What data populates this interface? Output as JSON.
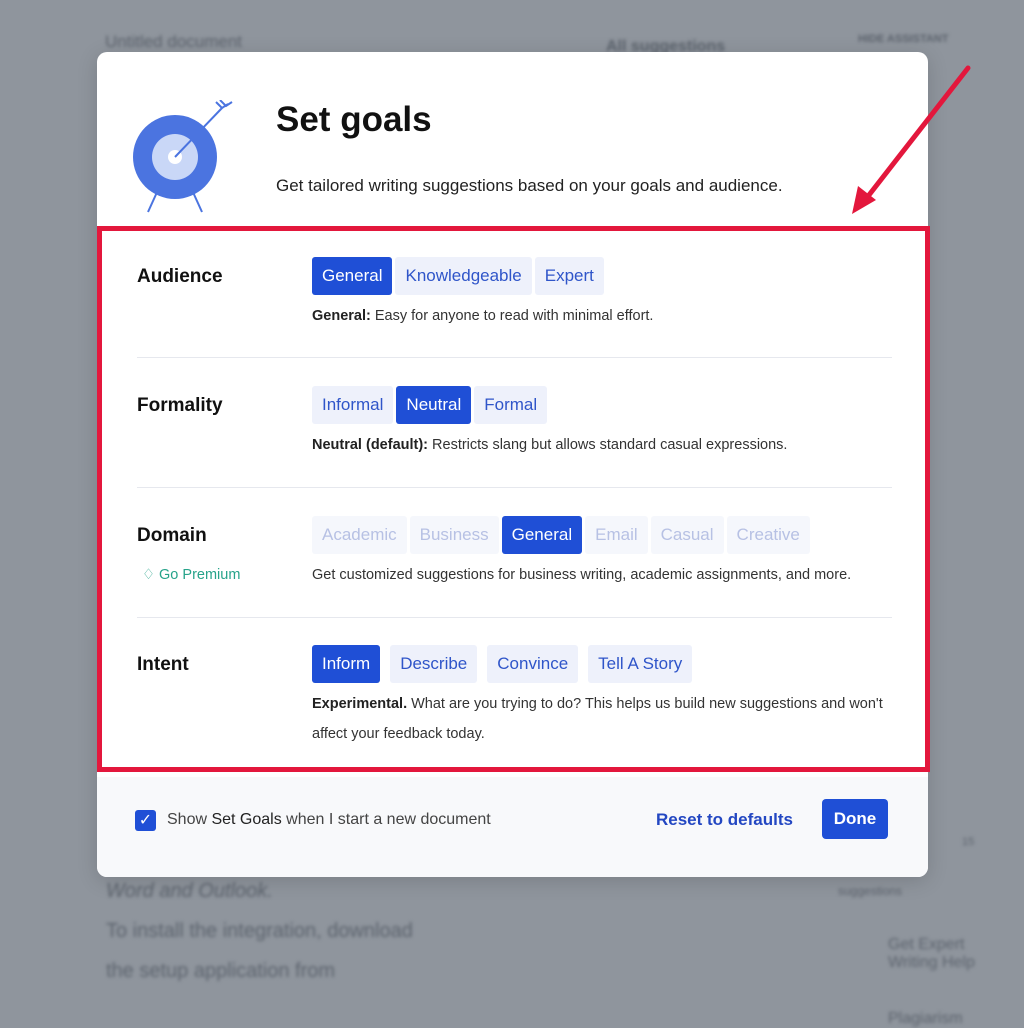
{
  "background": {
    "doc_title": "Untitled document",
    "all_suggestions": "All suggestions",
    "hide_assistant": "HIDE ASSISTANT",
    "doc_lines": [
      "Word and Outlook.",
      "To install the integration, download",
      "the setup application from"
    ],
    "sidebar_badge": "15",
    "sidebar_badge_label": "suggestions",
    "expert_help": "Get Expert Writing Help",
    "plagiarism": "Plagiarism"
  },
  "modal": {
    "title": "Set goals",
    "subtitle": "Get tailored writing suggestions based on your goals and audience.",
    "icon": "target-arrow-icon",
    "sections": [
      {
        "label": "Audience",
        "options": [
          "General",
          "Knowledgeable",
          "Expert"
        ],
        "selected": "General",
        "desc_bold": "General:",
        "desc": " Easy for anyone to read with minimal effort."
      },
      {
        "label": "Formality",
        "options": [
          "Informal",
          "Neutral",
          "Formal"
        ],
        "selected": "Neutral",
        "desc_bold": "Neutral (default):",
        "desc": " Restricts slang but allows standard casual expressions."
      },
      {
        "label": "Domain",
        "options": [
          "Academic",
          "Business",
          "General",
          "Email",
          "Casual",
          "Creative"
        ],
        "selected": "General",
        "premium": "Go Premium",
        "desc": "Get customized suggestions for business writing, academic assignments, and more."
      },
      {
        "label": "Intent",
        "options": [
          "Inform",
          "Describe",
          "Convince",
          "Tell A Story"
        ],
        "selected": "Inform",
        "desc_bold": "Experimental.",
        "desc": " What are you trying to do? This helps us build new suggestions and won't affect your feedback today."
      }
    ],
    "footer": {
      "checkbox_checked": true,
      "show_prefix": "Show ",
      "show_bold": "Set Goals",
      "show_suffix": " when I start a new document",
      "reset": "Reset to defaults",
      "done": "Done"
    }
  },
  "colors": {
    "accent": "#1f4fd6",
    "highlight_box": "#e3173c",
    "premium": "#27a38a"
  }
}
